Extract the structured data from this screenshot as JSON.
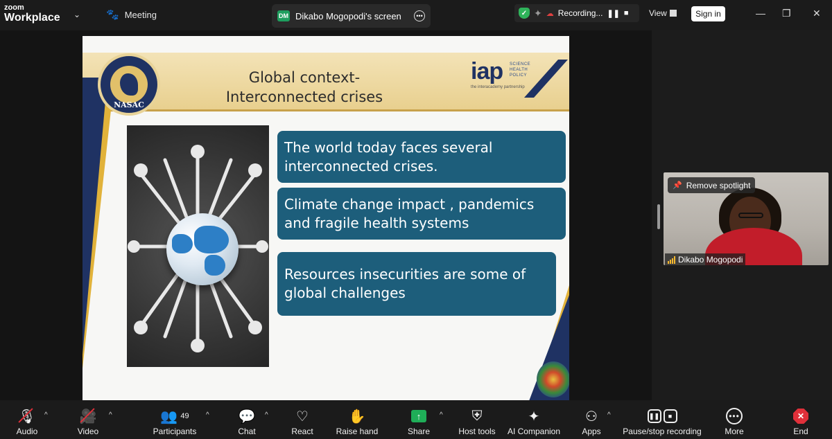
{
  "app": {
    "brand_top": "zoom",
    "brand_bottom": "Workplace",
    "meeting_label": "Meeting"
  },
  "screen_share": {
    "badge": "DM",
    "title": "Dikabo Mogopodi's screen"
  },
  "recording": {
    "status": "Recording..."
  },
  "header": {
    "view_label": "View",
    "signin_label": "Sign in"
  },
  "slide": {
    "title": "Global context-Interconnected crises",
    "logo_left_text": "NASAC",
    "logo_right_text": "iap",
    "logo_right_tags": "SCIENCE HEALTH POLICY",
    "logo_right_sub": "the interacademy partnership",
    "points": [
      "The world today faces several interconnected crises.",
      "Climate change impact , pandemics and fragile health systems",
      "Resources insecurities are some of global challenges"
    ]
  },
  "participant_video": {
    "spotlight_label": "Remove spotlight",
    "name": "Dikabo Mogopodi"
  },
  "toolbar": {
    "audio": "Audio",
    "video": "Video",
    "participants": "Participants",
    "participant_count": "49",
    "chat": "Chat",
    "react": "React",
    "raise_hand": "Raise hand",
    "share": "Share",
    "host_tools": "Host tools",
    "ai_companion": "AI Companion",
    "apps": "Apps",
    "pause_stop_recording": "Pause/stop recording",
    "more": "More",
    "end": "End"
  },
  "colors": {
    "slide_box": "#1d5e7b",
    "share_green": "#1fae58",
    "end_red": "#e0303a",
    "navy": "#1f3263",
    "gold": "#e1b23a"
  }
}
